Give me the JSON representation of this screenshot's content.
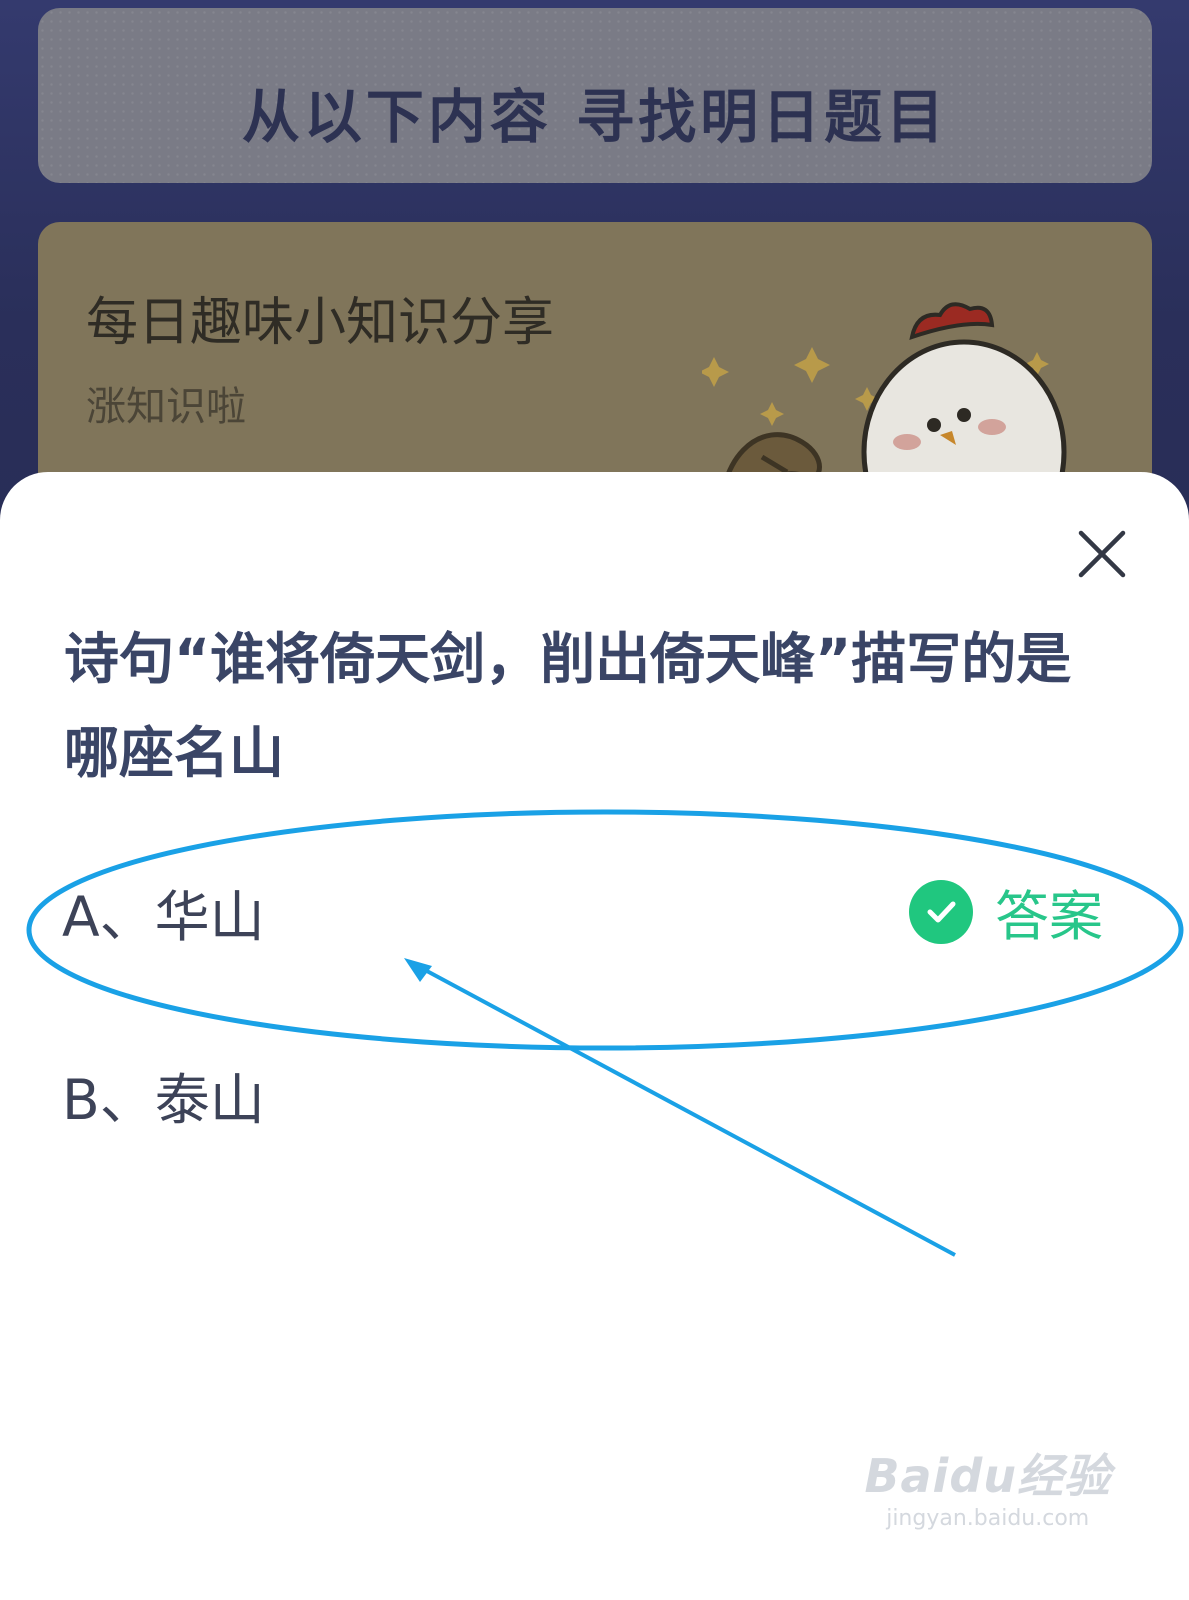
{
  "banner": {
    "title": "从以下内容 寻找明日题目"
  },
  "knowledge_card": {
    "title": "每日趣味小知识分享",
    "subtitle": "涨知识啦"
  },
  "dialog": {
    "question": "诗句“谁将倚天剑，削出倚天峰”描写的是哪座名山",
    "options": [
      {
        "label": "A、华山",
        "is_answer": true
      },
      {
        "label": "B、泰山",
        "is_answer": false
      }
    ],
    "answer_label": "答案"
  },
  "watermark": {
    "logo": "Baidu经验",
    "url": "jingyan.baidu.com"
  },
  "colors": {
    "answer_green": "#20c77f",
    "annotation_blue": "#1aa1e6",
    "question_text": "#3a4566"
  },
  "icons": {
    "close": "close-icon",
    "check": "check-circle-icon",
    "mascot": "chicken-mascot"
  }
}
